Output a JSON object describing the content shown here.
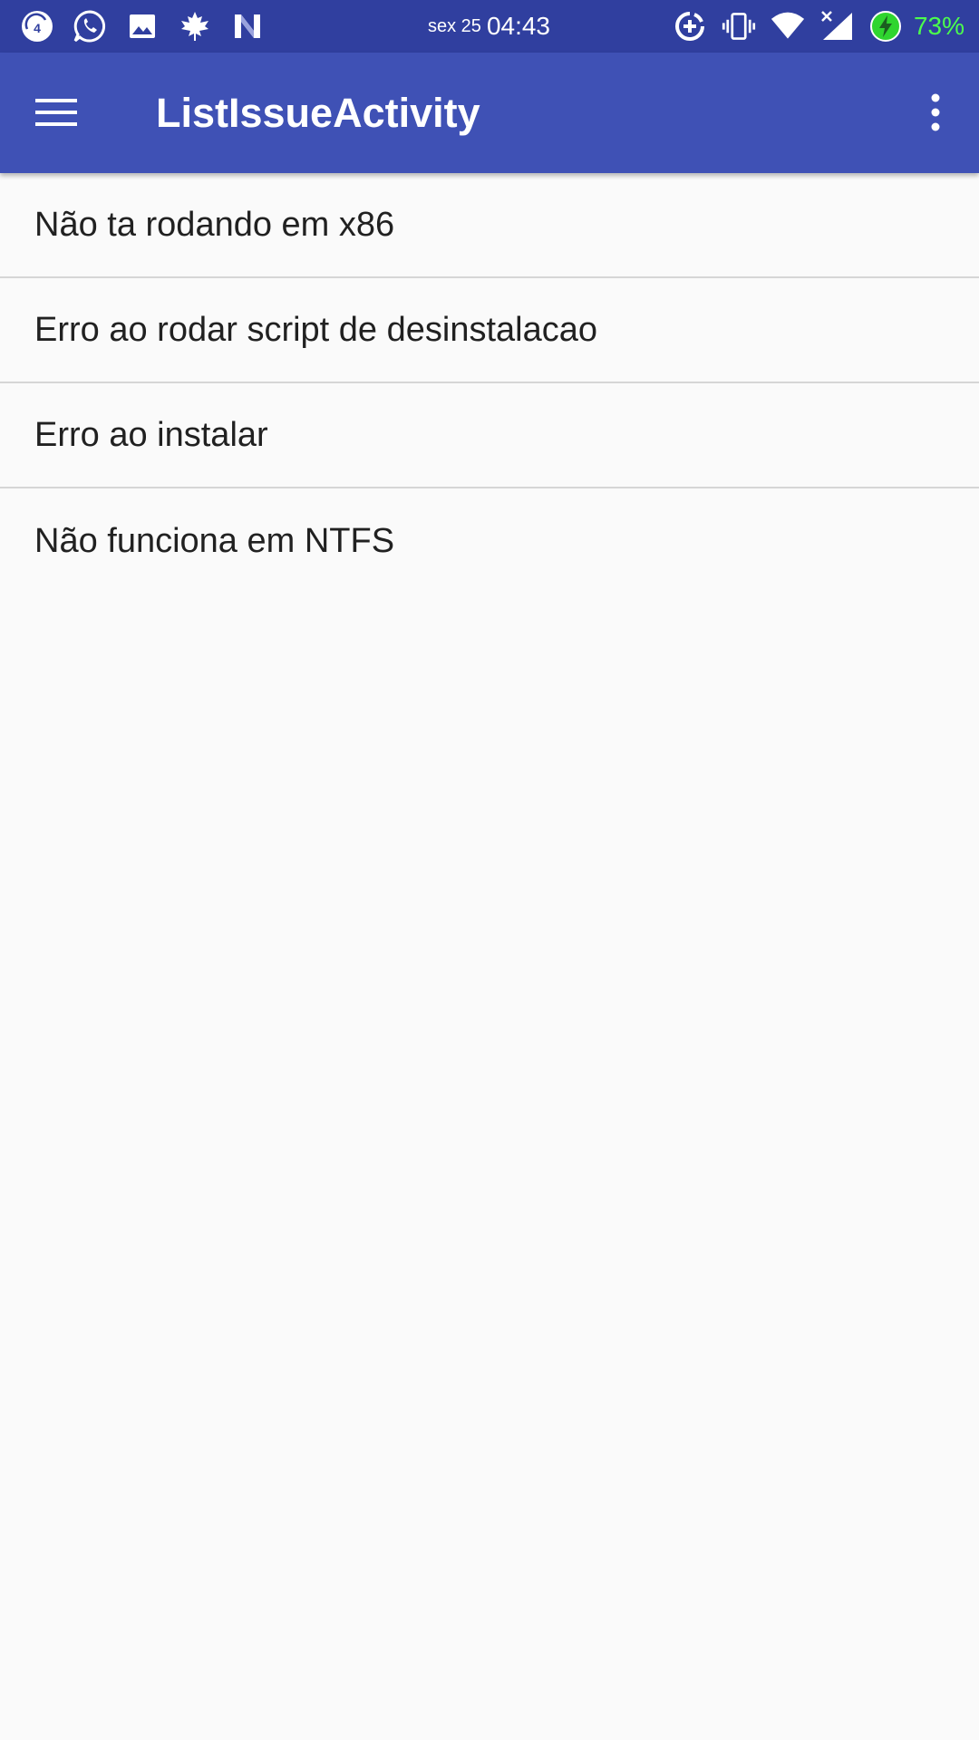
{
  "status_bar": {
    "notification_icons": [
      {
        "icon": "update-badge-icon",
        "badge": "4"
      },
      {
        "icon": "whatsapp-icon"
      },
      {
        "icon": "image-icon"
      },
      {
        "icon": "maple-leaf-icon"
      },
      {
        "icon": "n-logo-icon"
      }
    ],
    "date": "sex 25",
    "time": "04:43",
    "system_icons": [
      "data-saver-icon",
      "vibrate-icon",
      "wifi-icon",
      "signal-no-service-icon",
      "battery-charging-icon"
    ],
    "battery_percent": "73%",
    "colors": {
      "background": "#303f9f",
      "battery_text": "#4cff4c",
      "battery_icon": "#2fd52f"
    }
  },
  "app_bar": {
    "title": "ListIssueActivity",
    "menu_icon": "hamburger-menu-icon",
    "overflow_icon": "more-vertical-icon",
    "color": "#3f51b5"
  },
  "issues": [
    {
      "title": "Não ta rodando em x86"
    },
    {
      "title": "Erro ao rodar script de desinstalacao"
    },
    {
      "title": "Erro ao instalar"
    },
    {
      "title": "Não funciona em NTFS"
    }
  ]
}
